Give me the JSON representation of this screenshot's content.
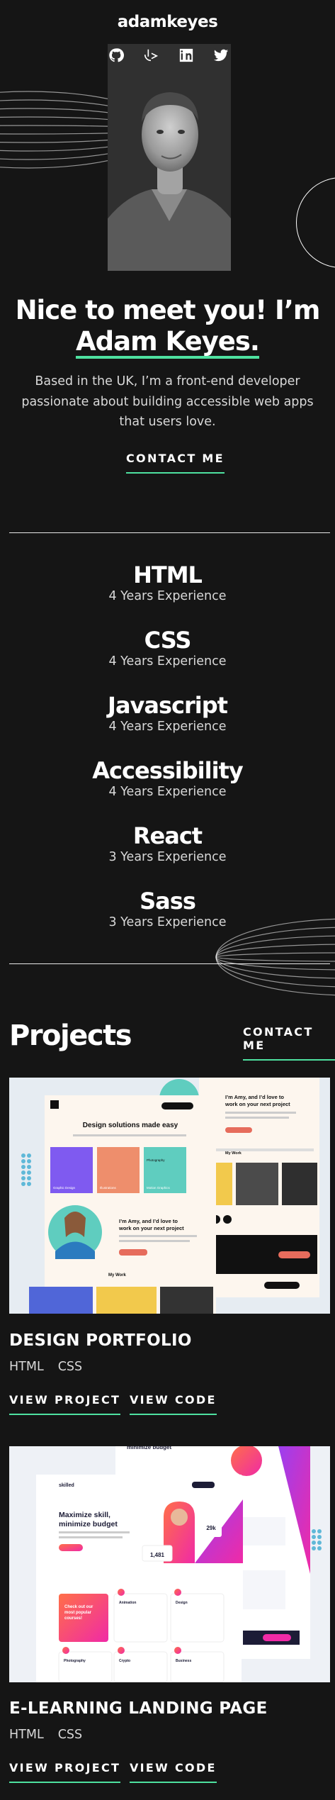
{
  "brand": "adamkeyes",
  "socials": [
    "github-icon",
    "frontend-mentor-icon",
    "linkedin-icon",
    "twitter-icon"
  ],
  "hero": {
    "greeting": "Nice to meet you! I’m",
    "name": "Adam Keyes.",
    "description": "Based in the UK, I’m a front-end developer passionate about building accessible web apps that users love.",
    "contact_label": "CONTACT ME"
  },
  "skills": [
    {
      "title": "HTML",
      "experience": "4 Years Experience"
    },
    {
      "title": "CSS",
      "experience": "4 Years Experience"
    },
    {
      "title": "Javascript",
      "experience": "4 Years Experience"
    },
    {
      "title": "Accessibility",
      "experience": "4 Years Experience"
    },
    {
      "title": "React",
      "experience": "3 Years Experience"
    },
    {
      "title": "Sass",
      "experience": "3 Years Experience"
    }
  ],
  "projects_section": {
    "heading": "Projects",
    "contact_label": "CONTACT ME"
  },
  "projects": [
    {
      "title": "DESIGN PORTFOLIO",
      "tags": [
        "HTML",
        "CSS"
      ],
      "view_project": "VIEW PROJECT",
      "view_code": "VIEW CODE",
      "thumb": {
        "headline": "Design solutions made easy",
        "intro": "I’m Amy, and I’d love to work on your next project",
        "section": "My Work",
        "tiles": [
          "Graphic Design",
          "Illustrations",
          "Photography",
          "Motion Graphics"
        ]
      }
    },
    {
      "title": "E-LEARNING LANDING PAGE",
      "tags": [
        "HTML",
        "CSS"
      ],
      "view_project": "VIEW PROJECT",
      "view_code": "VIEW CODE",
      "thumb": {
        "logo": "skilled",
        "headline": "Maximize skill, minimize budget",
        "stat_a": "1,481",
        "stat_b": "29k",
        "featured": "Check out our most popular courses!",
        "courses": [
          "Animation",
          "Design",
          "Photography",
          "Crypto",
          "Business"
        ]
      }
    }
  ],
  "colors": {
    "background": "#151515",
    "accent": "#4ee1a0",
    "text": "#ffffff",
    "muted": "#d9d9d9"
  }
}
